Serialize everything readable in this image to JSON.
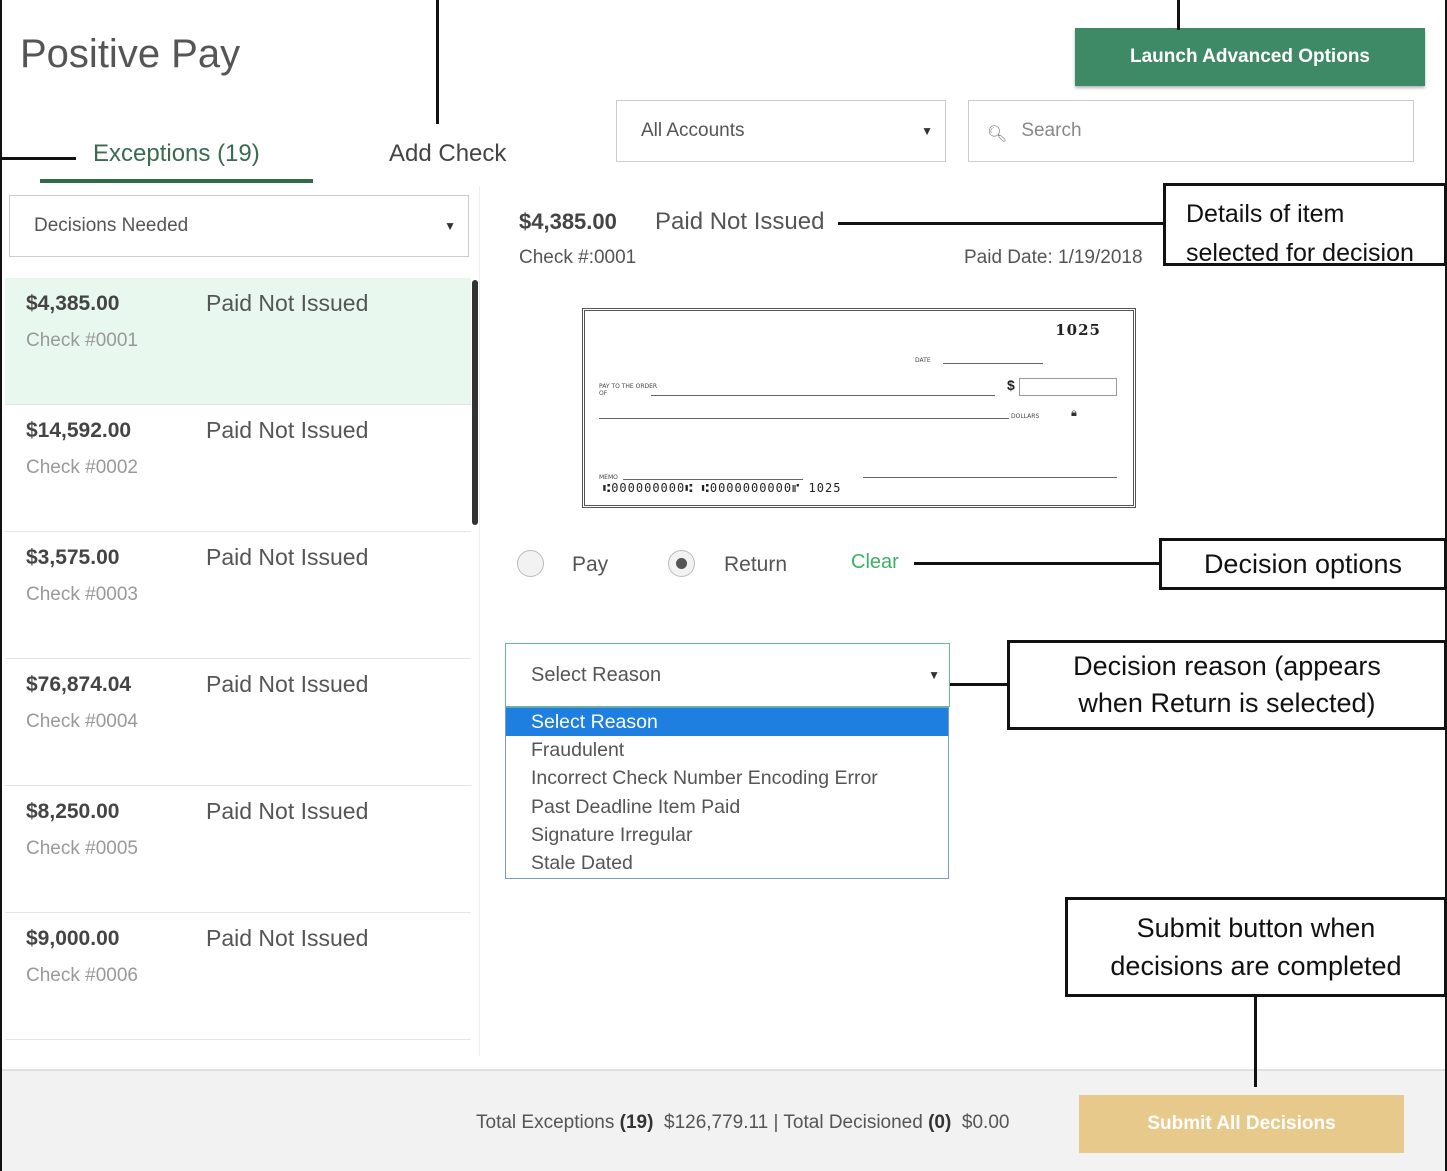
{
  "app": {
    "title": "Positive Pay",
    "launch_label": "Launch Advanced Options"
  },
  "tabs": [
    {
      "label": "Exceptions (19)",
      "active": true
    },
    {
      "label": "Add Check",
      "active": false
    }
  ],
  "filters": {
    "accounts_selected": "All Accounts",
    "search_placeholder": "Search",
    "decisions_selected": "Decisions Needed"
  },
  "exceptions": [
    {
      "amount": "$4,385.00",
      "status": "Paid Not Issued",
      "check": "Check #0001",
      "selected": true
    },
    {
      "amount": "$14,592.00",
      "status": "Paid Not Issued",
      "check": "Check #0002",
      "selected": false
    },
    {
      "amount": "$3,575.00",
      "status": "Paid Not Issued",
      "check": "Check #0003",
      "selected": false
    },
    {
      "amount": "$76,874.04",
      "status": "Paid Not Issued",
      "check": "Check #0004",
      "selected": false
    },
    {
      "amount": "$8,250.00",
      "status": "Paid Not Issued",
      "check": "Check #0005",
      "selected": false
    },
    {
      "amount": "$9,000.00",
      "status": "Paid Not Issued",
      "check": "Check #0006",
      "selected": false
    }
  ],
  "detail": {
    "amount": "$4,385.00",
    "status": "Paid Not Issued",
    "check_label": "Check #:0001",
    "paid_date": "Paid Date: 1/19/2018",
    "check_image": {
      "number": "1025",
      "micr": "⑆000000000⑆ ⑆0000000000⑈  1025",
      "date_label": "DATE",
      "payee_label": "PAY TO THE ORDER OF",
      "dollars_label": "DOLLARS",
      "memo_label": "MEMO",
      "currency_symbol": "$"
    }
  },
  "decision": {
    "pay_label": "Pay",
    "return_label": "Return",
    "selected": "Return",
    "clear_label": "Clear"
  },
  "reason": {
    "selected": "Select Reason",
    "options": [
      "Select Reason",
      "Fraudulent",
      "Incorrect Check Number Encoding Error",
      "Past Deadline Item Paid",
      "Signature Irregular",
      "Stale Dated"
    ]
  },
  "footer": {
    "total_exceptions_label": "Total Exceptions",
    "total_exceptions_count": "(19)",
    "total_exceptions_amount": "$126,779.11",
    "separator": "|",
    "total_decisioned_label": "Total Decisioned",
    "total_decisioned_count": "(0)",
    "total_decisioned_amount": "$0.00",
    "submit_label": "Submit All Decisions"
  },
  "callouts": {
    "details_line1": "Details of item",
    "details_line2": "selected for decision",
    "decision_options": "Decision options",
    "reason_line1": "Decision reason (appears",
    "reason_line2": "when Return is selected)",
    "submit_line1": "Submit button when",
    "submit_line2": "decisions are completed"
  },
  "colors": {
    "accent_green": "#3f8a66",
    "selected_row": "#e8f8ee",
    "link_green": "#3bb066",
    "dropdown_highlight": "#1e7fe0",
    "submit_disabled": "#e8c98c"
  }
}
